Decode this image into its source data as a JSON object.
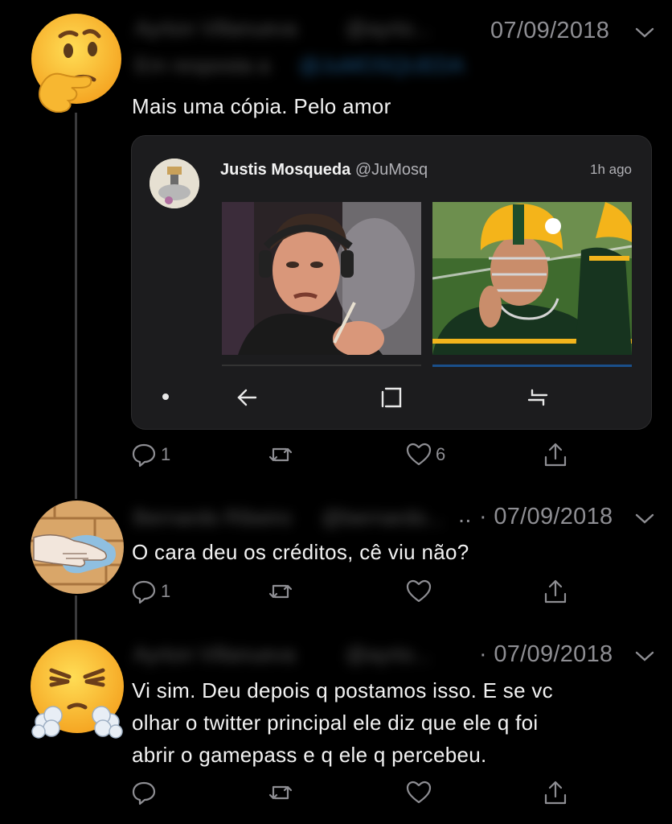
{
  "tweets": [
    {
      "author_blurred": "Ayrton Villanueva",
      "handle_blurred": "@ayrto...",
      "reply_to_blurred": "Em resposta a",
      "mention_blurred": "@JuMOSQUEDA",
      "date": "07/09/2018",
      "text": "Mais uma cópia. Pelo amor",
      "avatar": "thinking-face-emoji",
      "actions": {
        "reply_count": "1",
        "retweet_count": "",
        "like_count": "6"
      }
    },
    {
      "author_blurred": "Bernardo Ribeiro",
      "handle_blurred": "@bernardo...",
      "date_prefix": "..",
      "date": "· 07/09/2018",
      "text": "O cara deu os créditos, cê viu não?",
      "avatar": "hand-wiping-cloth-image",
      "actions": {
        "reply_count": "1",
        "retweet_count": "",
        "like_count": ""
      }
    },
    {
      "author_blurred": "Ayrton Villanueva",
      "handle_blurred": "@ayrto...",
      "date": "· 07/09/2018",
      "text_lines": [
        "Vi sim. Deu depois q postamos isso. E se vc",
        "olhar o twitter principal ele diz que ele q foi",
        "abrir o gamepass e q ele q percebeu."
      ],
      "avatar": "face-with-steam-emoji",
      "actions": {
        "reply_count": "",
        "retweet_count": "",
        "like_count": ""
      }
    }
  ],
  "quoted": {
    "name": "Justis Mosqueda",
    "handle": "@JuMosq",
    "time": "1h ago",
    "images": [
      "man-smoking-photo",
      "football-player-helmet-photo"
    ]
  },
  "colors": {
    "background": "#000000",
    "card": "#1c1c1e",
    "muted": "#8e8e93",
    "thread": "#3a3a3c"
  }
}
